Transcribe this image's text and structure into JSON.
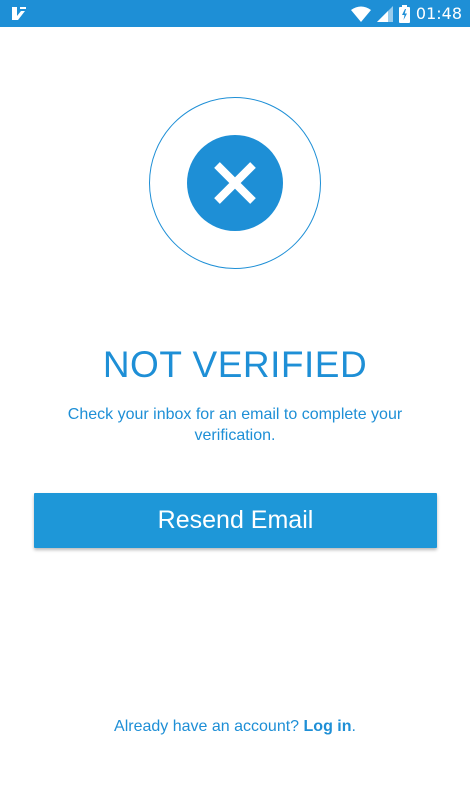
{
  "status_bar": {
    "time": "01:48",
    "icons": [
      "app-notification-icon",
      "wifi-icon",
      "signal-icon",
      "battery-charging-icon"
    ]
  },
  "main": {
    "status_icon": "close-icon",
    "title": "NOT VERIFIED",
    "message": "Check your inbox for an email to complete your verification.",
    "resend_label": "Resend Email"
  },
  "footer": {
    "prompt": "Already have an account?",
    "login_label": "Log in",
    "suffix": "."
  },
  "colors": {
    "accent": "#1e8fd6",
    "button": "#1e97d8",
    "background": "#ffffff"
  }
}
